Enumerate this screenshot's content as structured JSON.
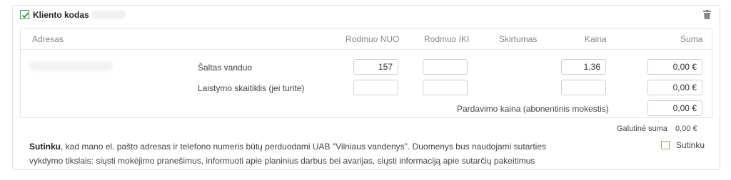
{
  "section": {
    "title": "Kliento kodas",
    "checked": true
  },
  "table": {
    "headers": {
      "address": "Adresas",
      "from": "Rodmuo NUO",
      "to": "Rodmuo IKI",
      "diff": "Skirtumas",
      "price": "Kaina",
      "sum": "Suma"
    },
    "rows": [
      {
        "label": "Šaltas vanduo",
        "from": "157",
        "to": "",
        "price": "1,36",
        "sum": "0,00 €"
      },
      {
        "label": "Laistymo skaitiklis (jei turite)",
        "from": "",
        "to": "",
        "price": "",
        "sum": "0,00 €"
      }
    ],
    "sale_label": "Pardavimo kaina (abonentinis mokestis)",
    "sale_value": "0,00 €"
  },
  "total": {
    "label": "Galutinė suma",
    "value": "0,00 €"
  },
  "consent": {
    "bold": "Sutinku",
    "line1_rest": ", kad mano el. pašto adresas ir telefono numeris būtų perduodami UAB \"Vilniaus vandenys\". Duomenys bus naudojami sutarties",
    "line2": "vykdymo tikslais: siųsti mokėjimo pranešimus, informuoti apie planinius darbus bei avarijas, siųsti informaciją apie sutarčių pakeitimus",
    "checkbox_label": "Sutinku",
    "checked": false
  },
  "colors": {
    "accent_green": "#3aa04a",
    "border": "#e2e2e2",
    "muted_text": "#888888"
  },
  "icons": {
    "header_checkbox": "check-icon",
    "delete": "trash-icon"
  }
}
